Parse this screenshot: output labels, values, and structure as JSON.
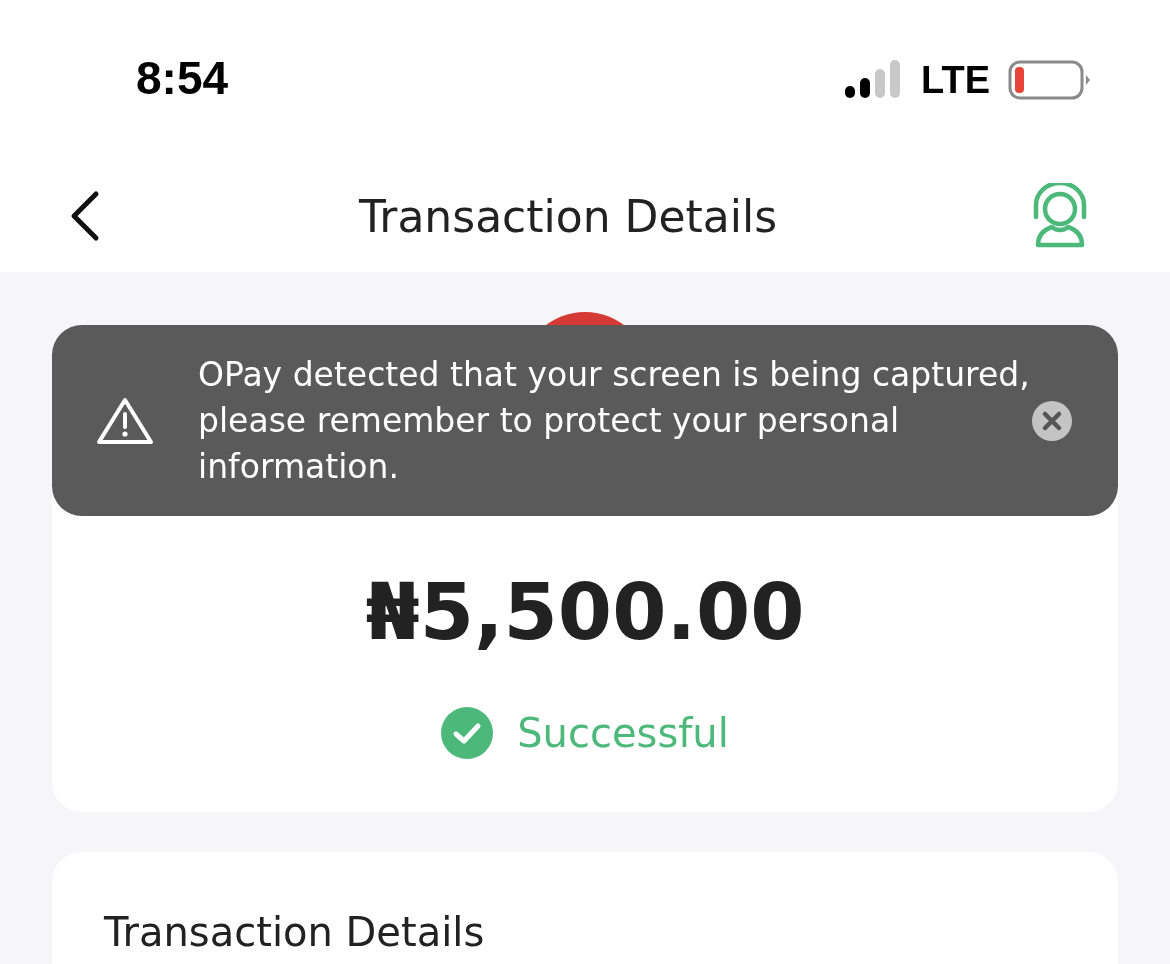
{
  "status_bar": {
    "time": "8:54",
    "network": "LTE"
  },
  "header": {
    "title": "Transaction Details"
  },
  "toast": {
    "message": "OPay detected that your screen is being captured, please remember to protect your personal information."
  },
  "summary": {
    "amount": "₦5,500.00",
    "status": {
      "kind": "success",
      "label": "Successful"
    }
  },
  "details": {
    "heading": "Transaction Details"
  }
}
